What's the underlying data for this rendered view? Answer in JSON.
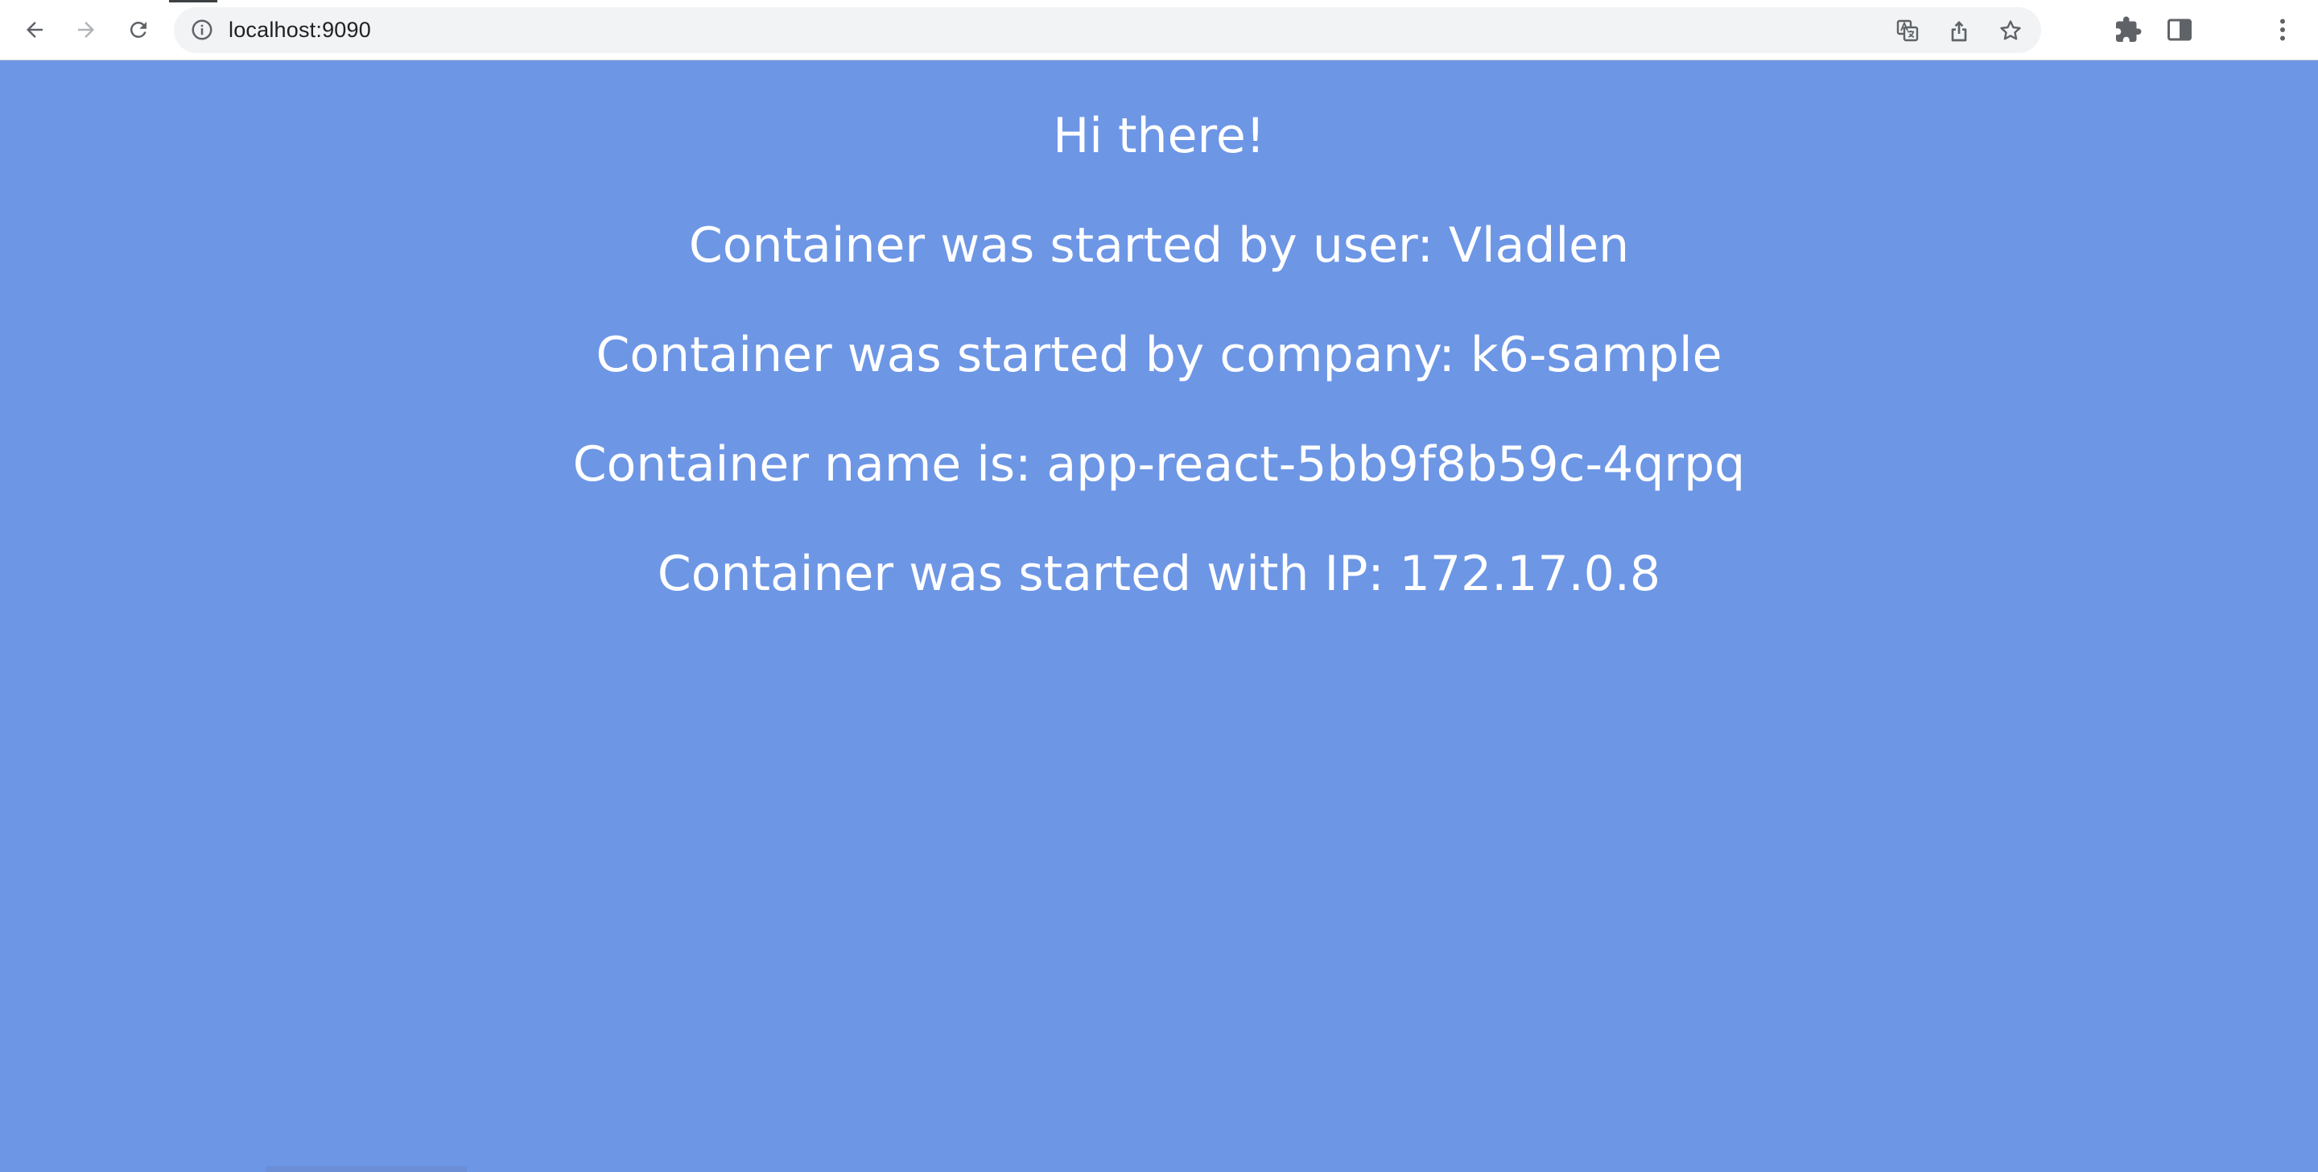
{
  "browser": {
    "url": "localhost:9090",
    "icons": {
      "back": "back-arrow-icon",
      "forward": "forward-arrow-icon",
      "reload": "reload-icon",
      "site_info": "info-icon",
      "translate": "translate-icon",
      "share": "share-icon",
      "bookmark": "star-icon",
      "extensions": "puzzle-icon",
      "side_panel": "side-panel-icon",
      "menu": "kebab-menu-icon"
    }
  },
  "page": {
    "background_color": "#6d96e5",
    "text_color": "#ffffff",
    "lines": {
      "greeting": "Hi there!",
      "user": "Container was started by user: Vladlen",
      "company": "Container was started by company: k6-sample",
      "name": "Container name is: app-react-5bb9f8b59c-4qrpq",
      "ip": "Container was started with IP: 172.17.0.8"
    }
  }
}
